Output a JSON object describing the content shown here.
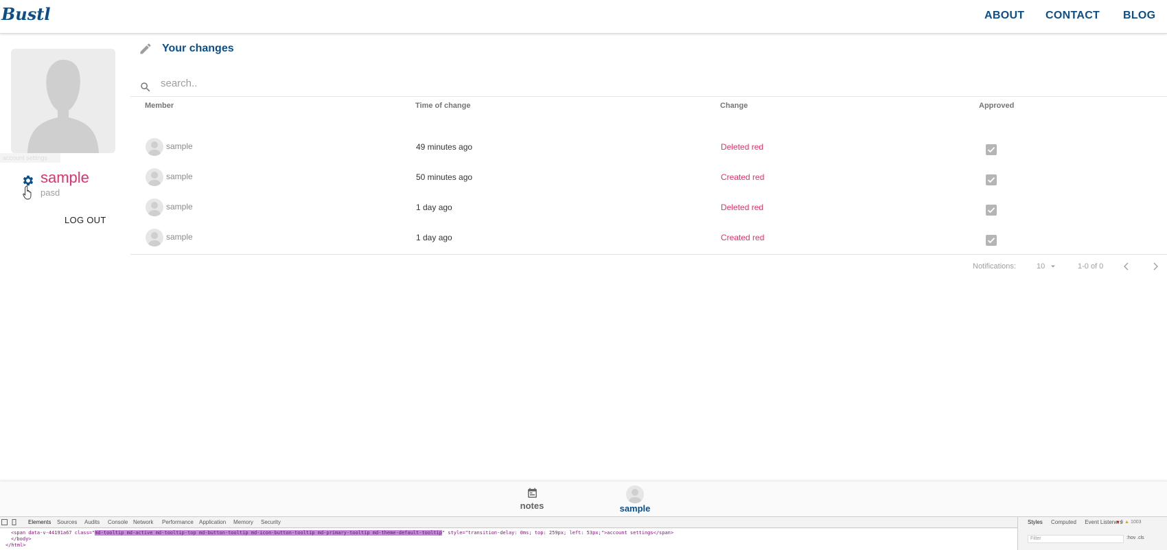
{
  "header": {
    "logo": "Bustl",
    "nav": [
      "ABOUT",
      "CONTACT",
      "BLOG"
    ]
  },
  "sidebar": {
    "tooltip": "account settings",
    "user_name": "sample",
    "user_sub": "pasd",
    "logout": "LOG OUT"
  },
  "main": {
    "title": "Your changes",
    "search_placeholder": "search..",
    "columns": [
      "Member",
      "Time of change",
      "Change",
      "Approved"
    ],
    "rows": [
      {
        "member": "sample",
        "time": "49 minutes ago",
        "change": "Deleted red",
        "approved": true
      },
      {
        "member": "sample",
        "time": "50 minutes ago",
        "change": "Created red",
        "approved": true
      },
      {
        "member": "sample",
        "time": "1 day ago",
        "change": "Deleted red",
        "approved": true
      },
      {
        "member": "sample",
        "time": "1 day ago",
        "change": "Created red",
        "approved": true
      }
    ],
    "pager": {
      "label": "Notifications:",
      "per_page": "10",
      "range": "1-0 of 0"
    }
  },
  "bottom_nav": {
    "notes": "notes",
    "profile": "sample"
  },
  "devtools": {
    "tabs": [
      "Elements",
      "Sources",
      "Audits",
      "Console",
      "Network",
      "Performance",
      "Application",
      "Memory",
      "Security"
    ],
    "line1_prefix": "<span data-v-44191a67 class=\"",
    "line1_highlight": "md-tooltip md-active md-tooltip-top md-button-tooltip md-icon-button-tooltip md-primary-tooltip md-theme-default-tooltip",
    "line1_suffix": "\" style=\"transition-delay: 0ms; top: 259px; left: 53px;\">account settings</span>",
    "line2": "</body>",
    "line3": "</html>",
    "side_tabs": [
      "Styles",
      "Computed",
      "Event Listeners"
    ],
    "filter_placeholder": "Filter",
    "filter_opts": ":hov .cls",
    "errors": "6",
    "warnings": "1003"
  },
  "colors": {
    "brand": "#0b4f8a",
    "accent": "#e0326e"
  }
}
